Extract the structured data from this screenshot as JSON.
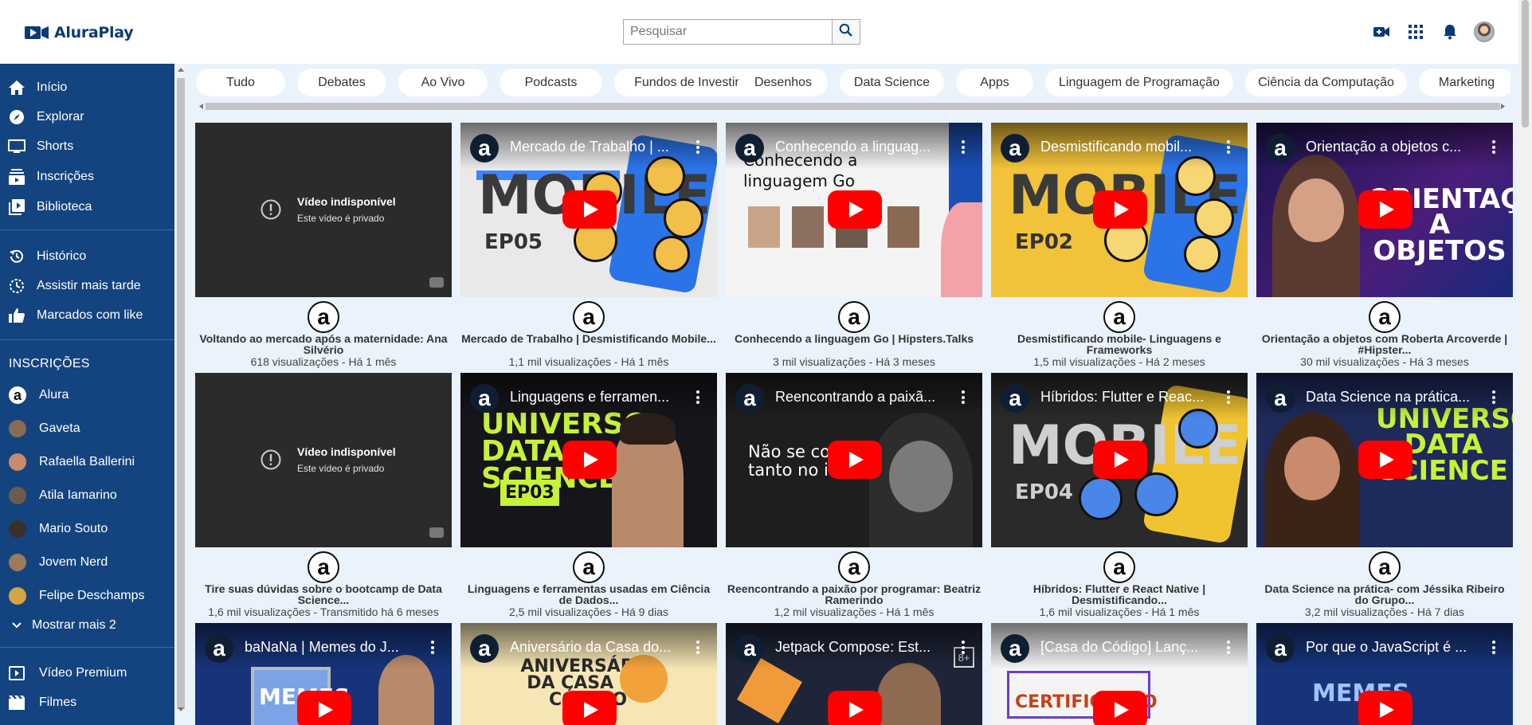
{
  "app": {
    "brand": "AluraPlay"
  },
  "search": {
    "placeholder": "Pesquisar"
  },
  "header_icons": [
    "video-camera-add-icon",
    "apps-grid-icon",
    "bell-icon",
    "user-avatar"
  ],
  "sidebar": {
    "main": [
      {
        "label": "Início",
        "icon": "home-icon"
      },
      {
        "label": "Explorar",
        "icon": "compass-icon"
      },
      {
        "label": "Shorts",
        "icon": "monitor-icon"
      },
      {
        "label": "Inscrições",
        "icon": "subscriptions-icon"
      },
      {
        "label": "Biblioteca",
        "icon": "library-icon"
      }
    ],
    "library": [
      {
        "label": "Histórico",
        "icon": "history-icon"
      },
      {
        "label": "Assistir mais tarde",
        "icon": "clock-icon"
      },
      {
        "label": "Marcados com like",
        "icon": "thumbs-up-icon"
      }
    ],
    "subscriptions_heading": "INSCRIÇÕES",
    "subscriptions": [
      {
        "label": "Alura",
        "color": "#0b0b0b"
      },
      {
        "label": "Gaveta",
        "color": "#8a6a55"
      },
      {
        "label": "Rafaella Ballerini",
        "color": "#c98b6b"
      },
      {
        "label": "Atila Iamarino",
        "color": "#6d5a4f"
      },
      {
        "label": "Mario Souto",
        "color": "#3b2f2a"
      },
      {
        "label": "Jovem Nerd",
        "color": "#9c7a5a"
      },
      {
        "label": "Felipe Deschamps",
        "color": "#d6a441"
      }
    ],
    "show_more": "Mostrar mais 2",
    "extra": [
      {
        "label": "Vídeo Premium",
        "icon": "premium-video-icon"
      },
      {
        "label": "Filmes",
        "icon": "film-icon"
      }
    ]
  },
  "chips": [
    "Tudo",
    "Debates",
    "Ao Vivo",
    "Podcasts",
    "Fundos de Investimento",
    "Desenhos",
    "Data Science",
    "Apps",
    "Linguagem de Programação",
    "Ciência da Computação",
    "Marketing"
  ],
  "unavailable": {
    "title": "Vídeo indisponível",
    "subtitle": "Este vídeo é privado"
  },
  "channel_glyph": "a",
  "videos": [
    {
      "thumb_title": "",
      "art": "",
      "title": "Voltando ao mercado após a maternidade: Ana Silvério",
      "meta": "618 visualizações - Há 1 mês"
    },
    {
      "thumb_title": "Mercado de Trabalho | ...",
      "art": "MOBILE",
      "title": "Mercado de Trabalho | Desmistificando Mobile...",
      "meta": "1,1 mil visualizações - Há 1 mês"
    },
    {
      "thumb_title": "Conhecendo a linguag...",
      "art": "Conhecendo a linguagem Go",
      "title": "Conhecendo a linguagem Go | Hipsters.Talks",
      "meta": "3 mil visualizações - Há 3 meses"
    },
    {
      "thumb_title": "Desmistificando mobil...",
      "art": "MOBILE",
      "title": "Desmistificando mobile- Linguagens e Frameworks",
      "meta": "1,5 mil visualizações - Há 2 meses"
    },
    {
      "thumb_title": "Orientação a objetos c...",
      "art": "ORIENTAÇÃO A OBJETOS",
      "title": "Orientação a objetos com Roberta Arcoverde | #Hipster...",
      "meta": "30 mil visualizações - Há 3 meses"
    },
    {
      "thumb_title": "",
      "art": "",
      "title": "Tire suas dúvidas sobre o bootcamp de Data Science...",
      "meta": "1,6 mil visualizações - Transmitido há 6 meses"
    },
    {
      "thumb_title": "Linguagens e ferramen...",
      "art": "UNIVERSO DATA SCIENCE",
      "title": "Linguagens e ferramentas usadas em Ciência de Dados...",
      "meta": "2,5 mil visualizações - Há 9 dias"
    },
    {
      "thumb_title": "Reencontrando a paixã...",
      "art": "Não se co tanto no i",
      "title": "Reencontrando a paixão por programar: Beatriz Ramerindo",
      "meta": "1,2 mil visualizações - Há 1 mês"
    },
    {
      "thumb_title": "Híbridos: Flutter e Reac...",
      "art": "MOBILE",
      "title": "Híbridos: Flutter e React Native | Desmistificando...",
      "meta": "1,6 mil visualizações - Há 1 mês"
    },
    {
      "thumb_title": "Data Science na prática...",
      "art": "UNIVERSO DATA SCIENCE",
      "title": "Data Science na prática- com Jéssika Ribeiro do Grupo...",
      "meta": "3,2 mil visualizações - Há 7 dias"
    },
    {
      "thumb_title": "baNaNa | Memes do J...",
      "art": "MEMES",
      "title": "",
      "meta": ""
    },
    {
      "thumb_title": "Aniversário da Casa do...",
      "art": "ANIVERSÁRIO DA CASA DO CÓDIGO",
      "title": "",
      "meta": ""
    },
    {
      "thumb_title": "Jetpack Compose: Est...",
      "art": "",
      "title": "",
      "meta": ""
    },
    {
      "thumb_title": "[Casa do Código] Lanç...",
      "art": "CERTIFICAÇÃO",
      "title": "",
      "meta": ""
    },
    {
      "thumb_title": "Por que o JavaScript é ...",
      "art": "MEMES",
      "title": "",
      "meta": ""
    }
  ]
}
